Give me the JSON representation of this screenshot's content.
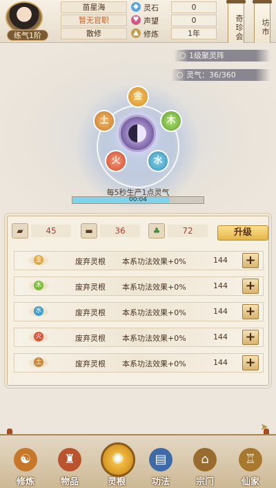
{
  "player": {
    "name": "苗星海",
    "title": "暂无官职",
    "status": "散修",
    "realm": "练气1阶"
  },
  "resources": [
    {
      "icon": "spirit-stone-icon",
      "label": "灵石",
      "value": "0",
      "color": "#5aa7e0"
    },
    {
      "icon": "reputation-icon",
      "label": "声望",
      "value": "0",
      "color": "#d05a86"
    },
    {
      "icon": "cultivation-icon",
      "label": "修炼",
      "value": "1年",
      "color": "#c4a050"
    }
  ],
  "side_buttons": {
    "treasure": "奇珍会",
    "market": "坊市"
  },
  "array": {
    "name": "1级聚灵阵",
    "qi_label": "灵气：36/360",
    "produce_text": "每5秒生产1点灵气",
    "timer": "00:04",
    "progress": 0.74,
    "elements": [
      {
        "key": "jin",
        "label": "金"
      },
      {
        "key": "mu",
        "label": "木"
      },
      {
        "key": "tu",
        "label": "土"
      },
      {
        "key": "huo",
        "label": "火"
      },
      {
        "key": "shui",
        "label": "水"
      }
    ]
  },
  "materials": [
    {
      "icon": "ore-icon",
      "value": "45"
    },
    {
      "icon": "wood-icon",
      "value": "36"
    },
    {
      "icon": "herb-icon",
      "value": "72"
    }
  ],
  "upgrade_label": "升级",
  "roots": [
    {
      "element": "金",
      "color": "#e0a640",
      "name": "废弃灵根",
      "effect": "本系功法效果+0%",
      "cost": "144"
    },
    {
      "element": "木",
      "color": "#7cbb3a",
      "name": "废弃灵根",
      "effect": "本系功法效果+0%",
      "cost": "144"
    },
    {
      "element": "水",
      "color": "#3f9ecb",
      "name": "废弃灵根",
      "effect": "本系功法效果+0%",
      "cost": "144"
    },
    {
      "element": "火",
      "color": "#d8553a",
      "name": "废弃灵根",
      "effect": "本系功法效果+0%",
      "cost": "144"
    },
    {
      "element": "土",
      "color": "#c88a3a",
      "name": "废弃灵根",
      "effect": "本系功法效果+0%",
      "cost": "144"
    }
  ],
  "plus_label": "+",
  "nav": [
    {
      "key": "cultivate",
      "label": "修炼",
      "icon": "meditating-figure-icon",
      "color": "#c7772a"
    },
    {
      "key": "items",
      "label": "物品",
      "icon": "bag-icon",
      "color": "#b9542e"
    },
    {
      "key": "roots",
      "label": "灵根",
      "icon": "triskelion-icon",
      "color": "#d89a22"
    },
    {
      "key": "skills",
      "label": "功法",
      "icon": "book-icon",
      "color": "#3f6aa8"
    },
    {
      "key": "sect",
      "label": "宗门",
      "icon": "building-icon",
      "color": "#9a6b2e"
    },
    {
      "key": "immortal",
      "label": "仙家",
      "icon": "pagoda-icon",
      "color": "#a8782e"
    }
  ]
}
